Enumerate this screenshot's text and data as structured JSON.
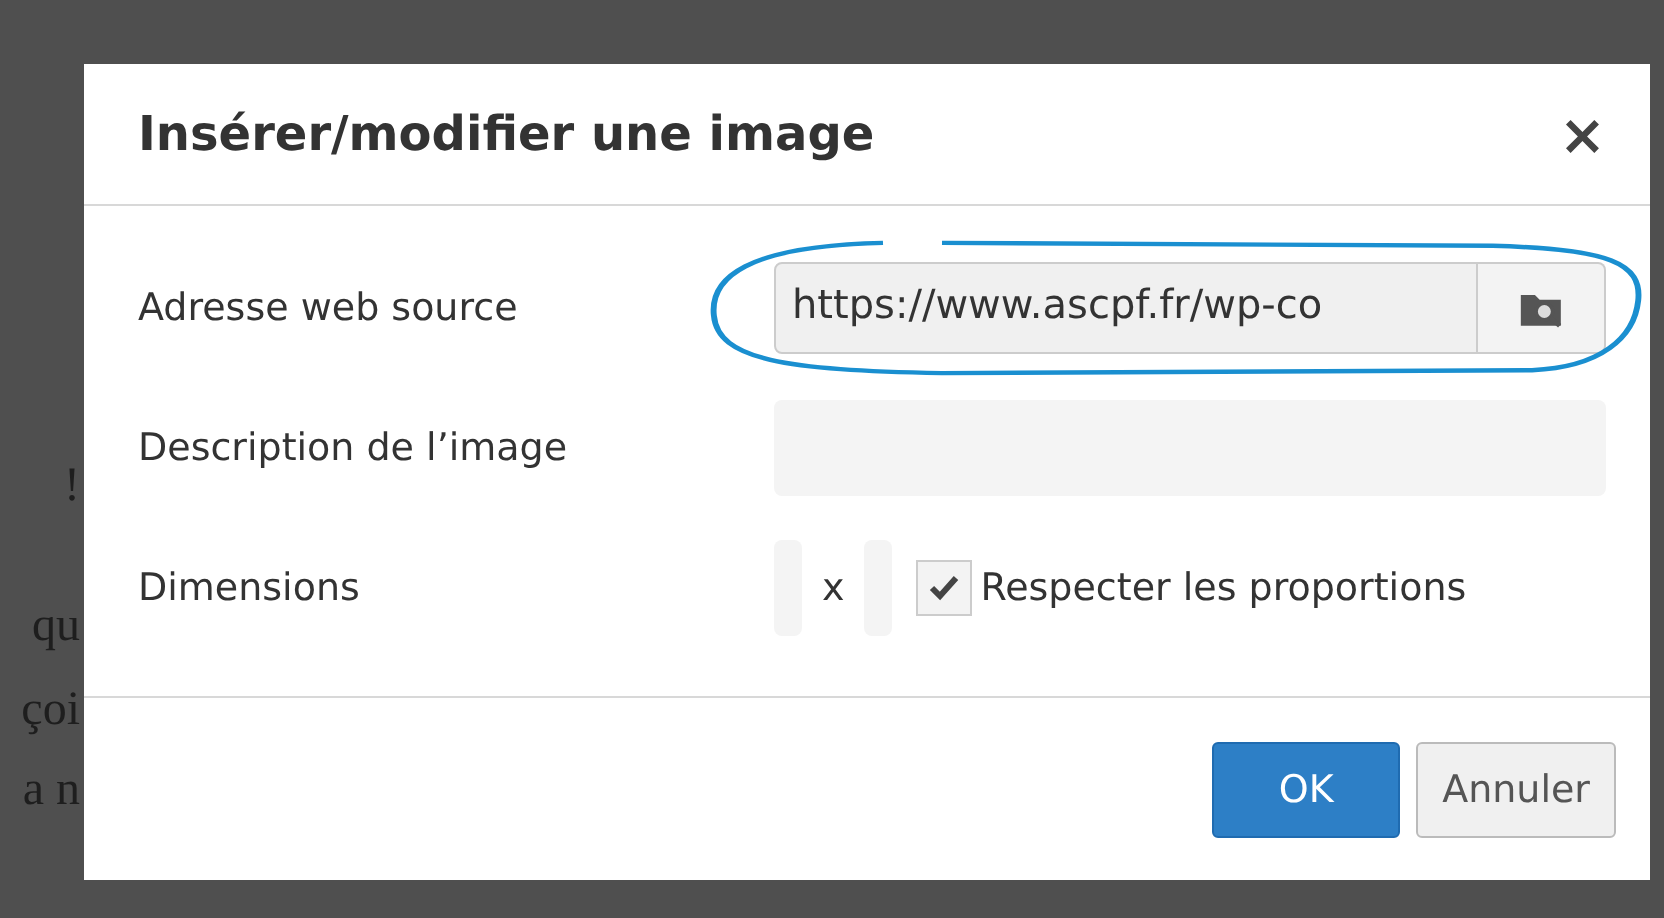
{
  "background_text": [
    "!",
    "qu",
    "çoi",
    "a n"
  ],
  "dialog": {
    "title": "Insérer/modifier une image",
    "close": "×",
    "fields": [
      {
        "kind": "url",
        "label": "Adresse web source",
        "value": "https://www.ascpf.fr/wp-co",
        "annotated": true
      },
      {
        "kind": "text",
        "label": "Description de l’image"
      },
      {
        "kind": "dimensions",
        "label": "Dimensions",
        "separator": "x",
        "checkbox_label": "Respecter les proportions",
        "checked": true
      }
    ],
    "buttons": [
      {
        "label": "OK",
        "primary": true
      },
      {
        "label": "Annuler",
        "primary": false
      }
    ]
  }
}
